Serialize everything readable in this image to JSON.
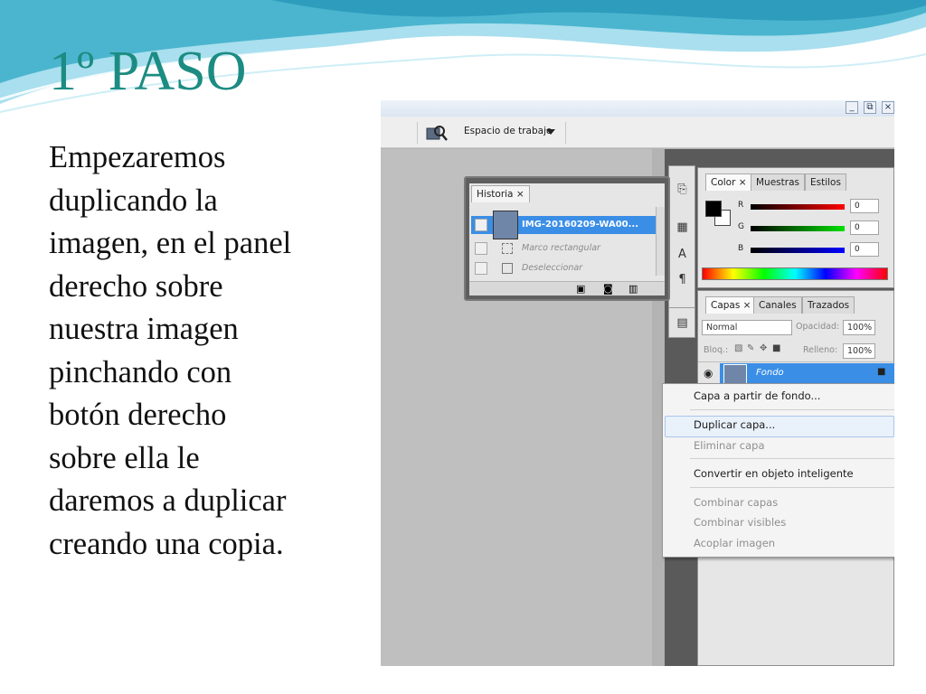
{
  "slide": {
    "title": "1º PASO",
    "body_lines": [
      "Empezaremos",
      "duplicando la",
      "imagen, en el panel",
      "derecho sobre",
      "nuestra imagen",
      "pinchando con",
      "botón derecho",
      "sobre ella le",
      "daremos a duplicar",
      "creando una copia."
    ],
    "colors": {
      "title": "#1c8c82",
      "wave_dark": "#4bb5cf",
      "wave_light": "#a9dfee"
    }
  },
  "screenshot": {
    "window_buttons": [
      "_",
      "⧉",
      "×"
    ],
    "options_bar": {
      "workspace_label": "Espacio de trabajo"
    },
    "history_panel": {
      "tab": "Historia ×",
      "rows": [
        {
          "label": "IMG-20160209-WA00...",
          "selected": true
        },
        {
          "label": "Marco rectangular",
          "selected": false
        },
        {
          "label": "Deseleccionar",
          "selected": false
        }
      ]
    },
    "color_panel": {
      "tabs": [
        "Color ×",
        "Muestras",
        "Estilos"
      ],
      "channels": [
        {
          "label": "R",
          "value": "0"
        },
        {
          "label": "G",
          "value": "0"
        },
        {
          "label": "B",
          "value": "0"
        }
      ]
    },
    "layers_panel": {
      "tabs": [
        "Capas ×",
        "Canales",
        "Trazados"
      ],
      "blend_mode": "Normal",
      "opacity_label": "Opacidad:",
      "opacity_value": "100%",
      "lock_label": "Bloq.:",
      "fill_label": "Relleno:",
      "fill_value": "100%",
      "layer_name": "Fondo"
    },
    "context_menu": {
      "items": [
        {
          "label": "Capa a partir de fondo...",
          "enabled": true
        },
        {
          "label": "Duplicar capa...",
          "enabled": true,
          "highlighted": true
        },
        {
          "label": "Eliminar capa",
          "enabled": false
        },
        {
          "label": "Convertir en objeto inteligente",
          "enabled": true
        },
        {
          "label": "Combinar capas",
          "enabled": false
        },
        {
          "label": "Combinar visibles",
          "enabled": false
        },
        {
          "label": "Acoplar imagen",
          "enabled": false
        }
      ]
    }
  }
}
